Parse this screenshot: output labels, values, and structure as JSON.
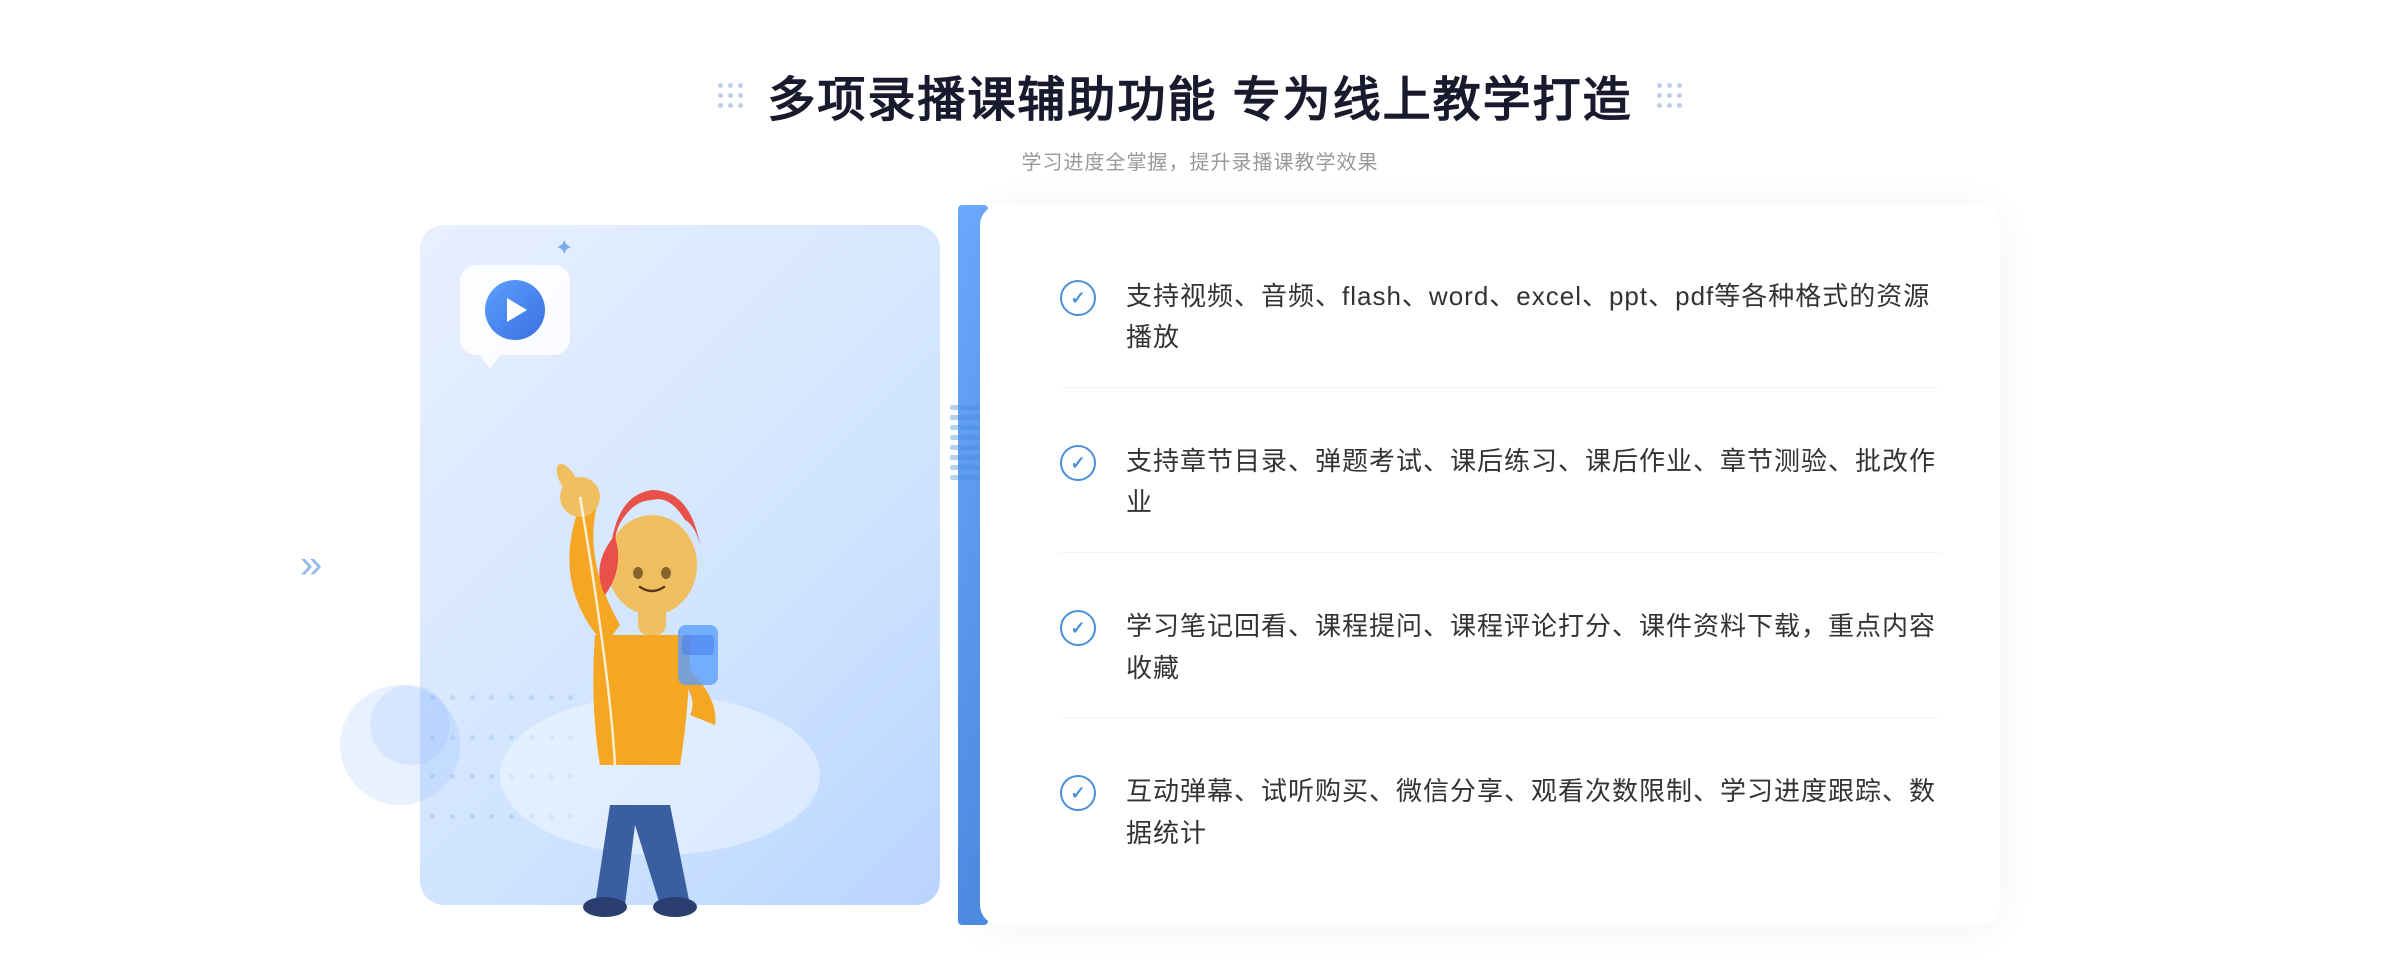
{
  "header": {
    "title": "多项录播课辅助功能 专为线上教学打造",
    "subtitle": "学习进度全掌握，提升录播课教学效果"
  },
  "features": [
    {
      "id": "feature-1",
      "text": "支持视频、音频、flash、word、excel、ppt、pdf等各种格式的资源播放"
    },
    {
      "id": "feature-2",
      "text": "支持章节目录、弹题考试、课后练习、课后作业、章节测验、批改作业"
    },
    {
      "id": "feature-3",
      "text": "学习笔记回看、课程提问、课程评论打分、课件资料下载，重点内容收藏"
    },
    {
      "id": "feature-4",
      "text": "互动弹幕、试听购买、微信分享、观看次数限制、学习进度跟踪、数据统计"
    }
  ],
  "decoration": {
    "chevron_left": "»",
    "sparkle": "✦"
  }
}
